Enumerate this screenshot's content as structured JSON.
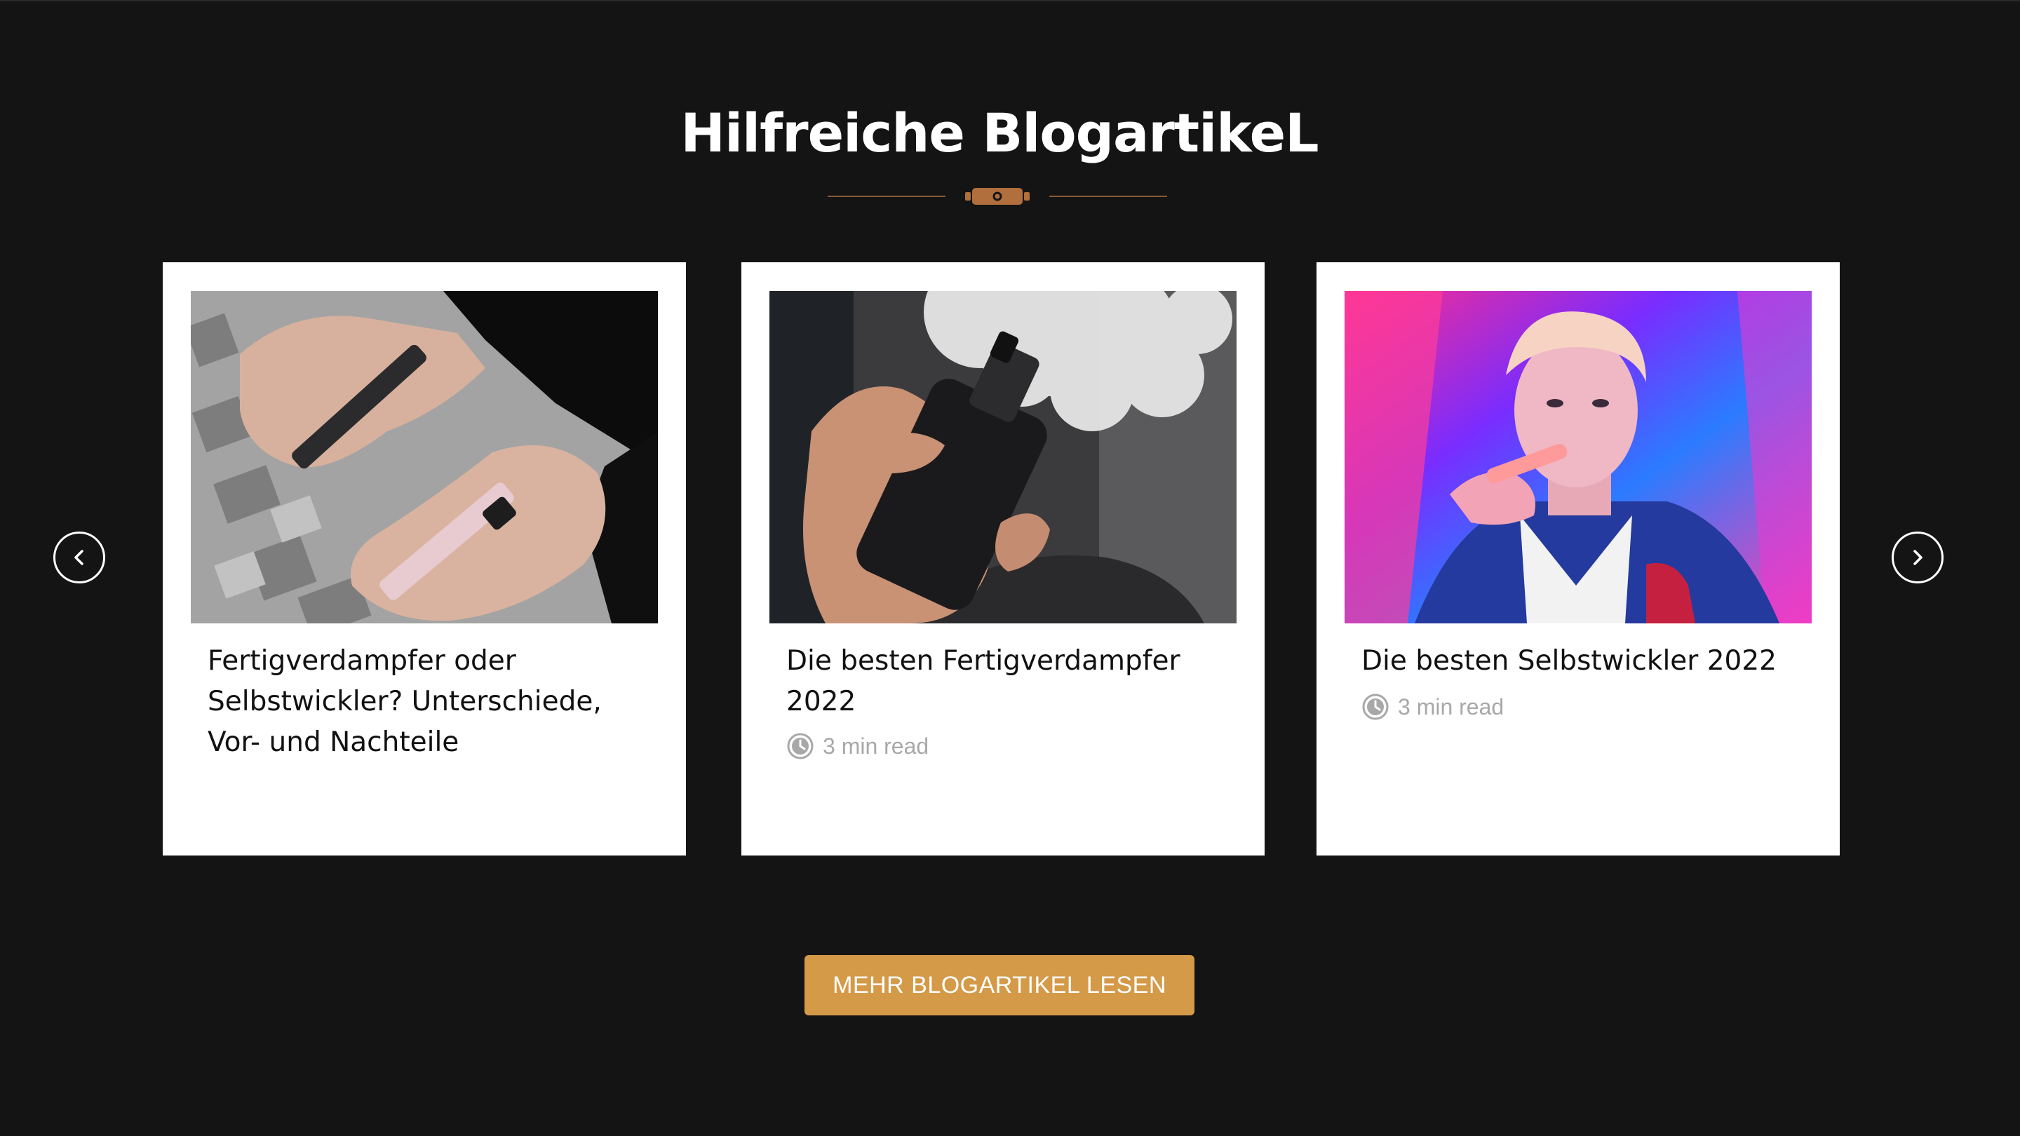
{
  "section": {
    "title": "Hilfreiche BlogartikeL"
  },
  "colors": {
    "background": "#151414",
    "accent": "#d49a48",
    "divider": "#8a5a35",
    "card_bg": "#ffffff",
    "meta_text": "#a8a8a8"
  },
  "carousel": {
    "prev_icon": "chevron-left-icon",
    "next_icon": "chevron-right-icon"
  },
  "posts": [
    {
      "title": "Fertigverdampfer oder Selbstwickler? Unterschiede, Vor- und Nachteile",
      "read_time": "",
      "image_icon": "photo-hands-holding-two-pod-vapes"
    },
    {
      "title": "Die besten Fertigverdampfer 2022",
      "read_time": "3 min read",
      "image_icon": "photo-hand-holding-vape-mod-with-smoke"
    },
    {
      "title": "Die besten Selbstwickler 2022",
      "read_time": "3 min read",
      "image_icon": "photo-woman-neon-light-vaping"
    }
  ],
  "cta": {
    "label": "MEHR BLOGARTIKEL LESEN"
  }
}
